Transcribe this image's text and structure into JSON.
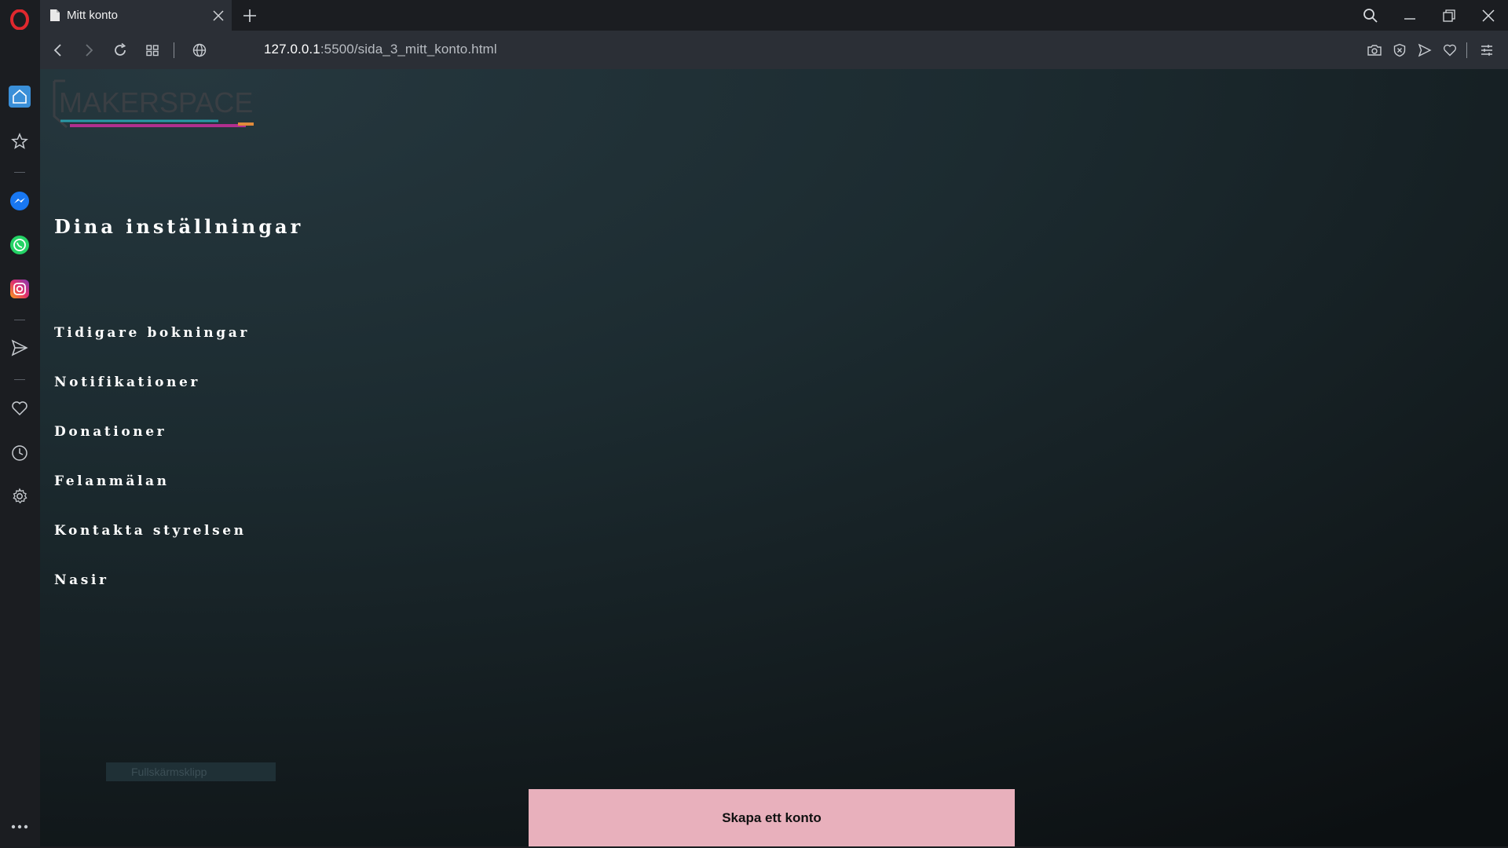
{
  "browser": {
    "tab_title": "Mitt konto",
    "url_host": "127.0.0.1",
    "url_rest": ":5500/sida_3_mitt_konto.html",
    "accent": "#e0282e"
  },
  "page": {
    "logo_text": "MAKERSPACE",
    "settings_title": "Dina inställningar",
    "menu": [
      {
        "label": "Tidigare bokningar"
      },
      {
        "label": "Notifikationer"
      },
      {
        "label": "Donationer"
      },
      {
        "label": "Felanmälan"
      },
      {
        "label": "Kontakta styrelsen"
      },
      {
        "label": "Nasir"
      }
    ],
    "snip_text": "Fullskärmsklipp",
    "create_account_label": "Skapa ett konto",
    "button_color": "#e8b0bc"
  }
}
